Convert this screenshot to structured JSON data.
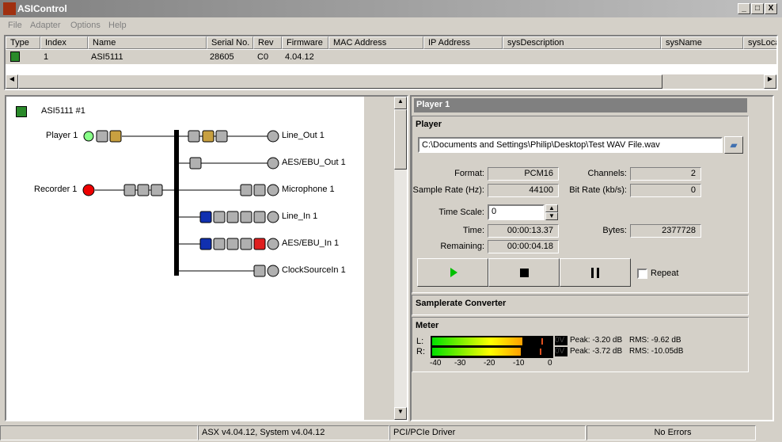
{
  "window": {
    "title": "ASIControl",
    "min": "_",
    "max": "□",
    "close": "X"
  },
  "menu": [
    "File",
    "Adapter",
    "Options",
    "Help"
  ],
  "adapter_list": {
    "columns": [
      "Type",
      "Index",
      "Name",
      "Serial No.",
      "Rev",
      "Firmware",
      "MAC Address",
      "IP Address",
      "sysDescription",
      "sysName",
      "sysLocat"
    ],
    "rows": [
      {
        "type_icon": "adapter-card-icon",
        "index": "1",
        "name": "ASI5111",
        "serial": "28605",
        "rev": "C0",
        "firmware": "4.04.12"
      }
    ]
  },
  "diagram": {
    "adapter": "ASI5111 #1",
    "player": "Player  1",
    "recorder": "Recorder  1",
    "outputs": [
      "Line_Out  1",
      "AES/EBU_Out  1"
    ],
    "inputs": [
      "Microphone  1",
      "Line_In  1",
      "AES/EBU_In  1",
      "ClockSourceIn  1"
    ]
  },
  "player_panel": {
    "header": "Player  1",
    "title": "Player",
    "file": "C:\\Documents and Settings\\Philip\\Desktop\\Test WAV File.wav",
    "format_label": "Format:",
    "format": "PCM16",
    "channels_label": "Channels:",
    "channels": "2",
    "samplerate_label": "Sample Rate (Hz):",
    "samplerate": "44100",
    "bitrate_label": "Bit Rate (kb/s):",
    "bitrate": "0",
    "timescale_label": "Time Scale:",
    "timescale": "0",
    "time_label": "Time:",
    "time": "00:00:13.37",
    "bytes_label": "Bytes:",
    "bytes": "2377728",
    "remaining_label": "Remaining:",
    "remaining": "00:00:04.18",
    "repeat_label": "Repeat",
    "repeat": false
  },
  "src_panel": {
    "title": "Samplerate Converter"
  },
  "meter": {
    "title": "Meter",
    "scale": [
      "-40",
      "-30",
      "-20",
      "-10",
      "0"
    ],
    "channels": [
      {
        "label": "L:",
        "ov": "0V",
        "peak": "Peak: -3.20 dB",
        "rms": "RMS: -9.62 dB",
        "rms_db": -9.62,
        "peak_db": -3.2
      },
      {
        "label": "R:",
        "ov": "0V",
        "peak": "Peak: -3.72 dB",
        "rms": "RMS: -10.05dB",
        "rms_db": -10.05,
        "peak_db": -3.72
      }
    ]
  },
  "status": [
    "",
    "ASX v4.04.12, System v4.04.12",
    "PCI/PCIe Driver",
    "No Errors"
  ]
}
